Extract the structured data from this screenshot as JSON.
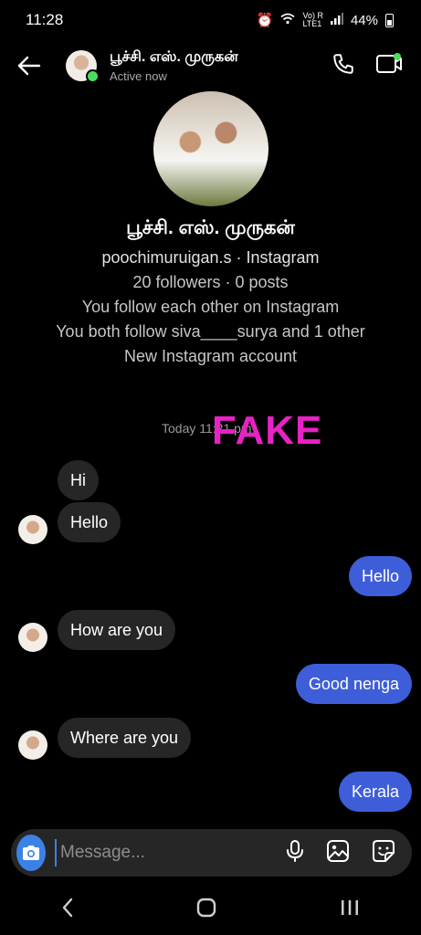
{
  "status_bar": {
    "time": "11:28",
    "network": "Vo) R\nLTE1",
    "battery": "44%"
  },
  "header": {
    "name": "பூச்சி. எஸ். முருகன்",
    "status": "Active now"
  },
  "profile": {
    "name": "பூச்சி. எஸ். முருகன்",
    "handle": "poochimuruigan.s · Instagram",
    "stats": "20 followers · 0 posts",
    "mutual": "You follow each other on Instagram",
    "both_follow": "You both follow siva____surya and 1 other",
    "account_note": "New Instagram account"
  },
  "thread": {
    "timestamp": "Today 11:21 pm",
    "watermark": "FAKE",
    "messages": [
      {
        "from": "them",
        "text": "Hi"
      },
      {
        "from": "them",
        "text": "Hello"
      },
      {
        "from": "me",
        "text": "Hello"
      },
      {
        "from": "them",
        "text": "How are you"
      },
      {
        "from": "me",
        "text": "Good nenga"
      },
      {
        "from": "them",
        "text": "Where are you"
      },
      {
        "from": "me",
        "text": "Kerala"
      }
    ]
  },
  "composer": {
    "placeholder": "Message..."
  },
  "icons": [
    "back-arrow-icon",
    "phone-icon",
    "video-call-icon",
    "camera-icon",
    "microphone-icon",
    "gallery-icon",
    "sticker-icon",
    "nav-back-icon",
    "nav-home-icon",
    "nav-recents-icon"
  ],
  "colors": {
    "outgoing_bubble": "#3e5ed9",
    "incoming_bubble": "#262626",
    "watermark": "#e822c4",
    "online": "#4ade5f",
    "camera_button": "#3b82e6"
  }
}
